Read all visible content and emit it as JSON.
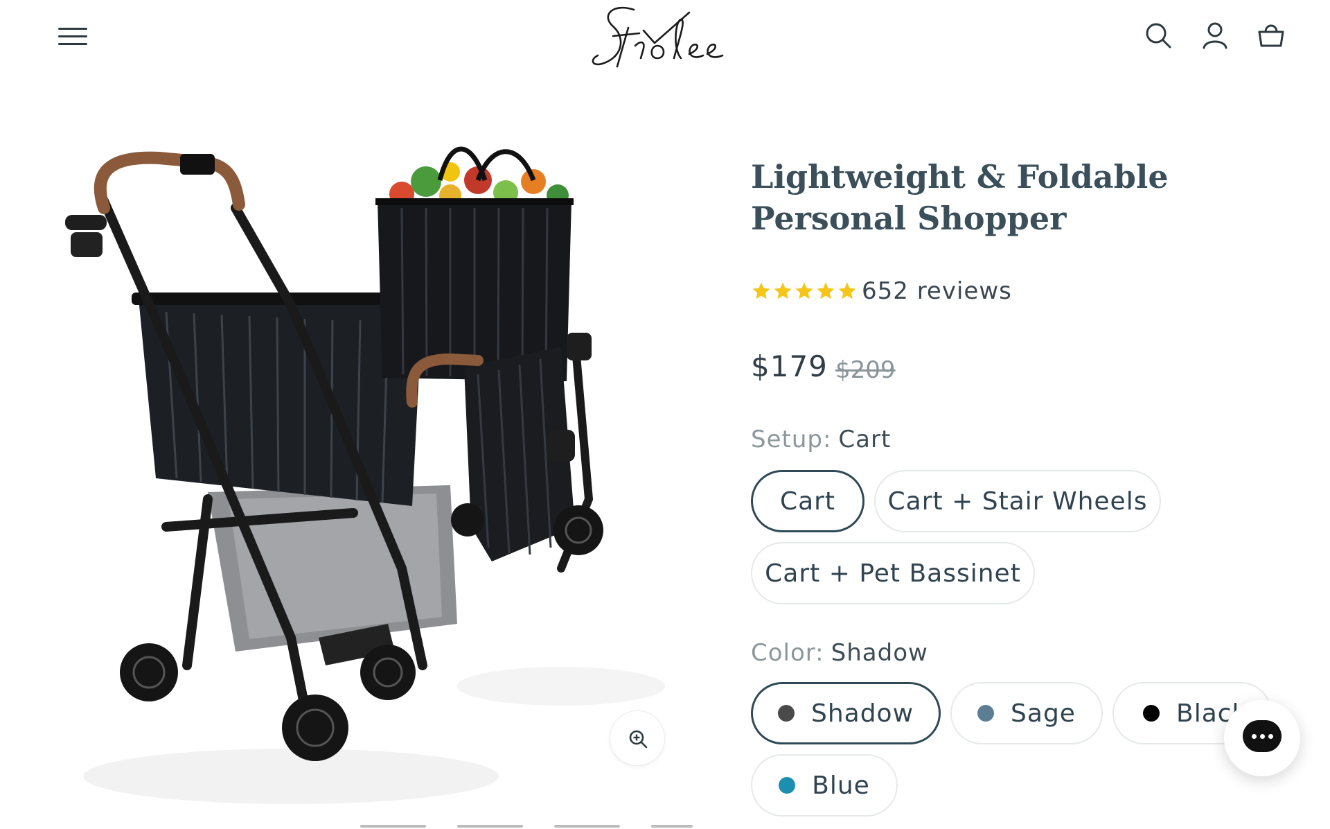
{
  "header": {
    "menu_icon": "hamburger-menu-icon",
    "logo_text": "Strolee",
    "search_icon": "search-icon",
    "account_icon": "user-icon",
    "cart_icon": "shopping-basket-icon"
  },
  "gallery": {
    "zoom_icon": "zoom-in-icon"
  },
  "product": {
    "title": "Lightweight & Foldable Personal Shopper",
    "rating_stars": 5,
    "reviews": "652 reviews",
    "price": "$179",
    "compare_price": "$209"
  },
  "setup": {
    "label": "Setup:",
    "selected": "Cart",
    "options": [
      "Cart",
      "Cart + Stair Wheels",
      "Cart + Pet Bassinet"
    ]
  },
  "color": {
    "label": "Color:",
    "selected": "Shadow",
    "options": [
      {
        "name": "Shadow",
        "swatch": "#4a4a4a"
      },
      {
        "name": "Sage",
        "swatch": "#5b7e95"
      },
      {
        "name": "Black",
        "swatch": "#000000"
      },
      {
        "name": "Blue",
        "swatch": "#1c8fb0"
      }
    ]
  },
  "chat": {
    "icon": "chat-bubble-icon"
  },
  "colors": {
    "heading": "#3a4f59",
    "star": "#f5c518",
    "selected_border": "#2f4a57"
  }
}
